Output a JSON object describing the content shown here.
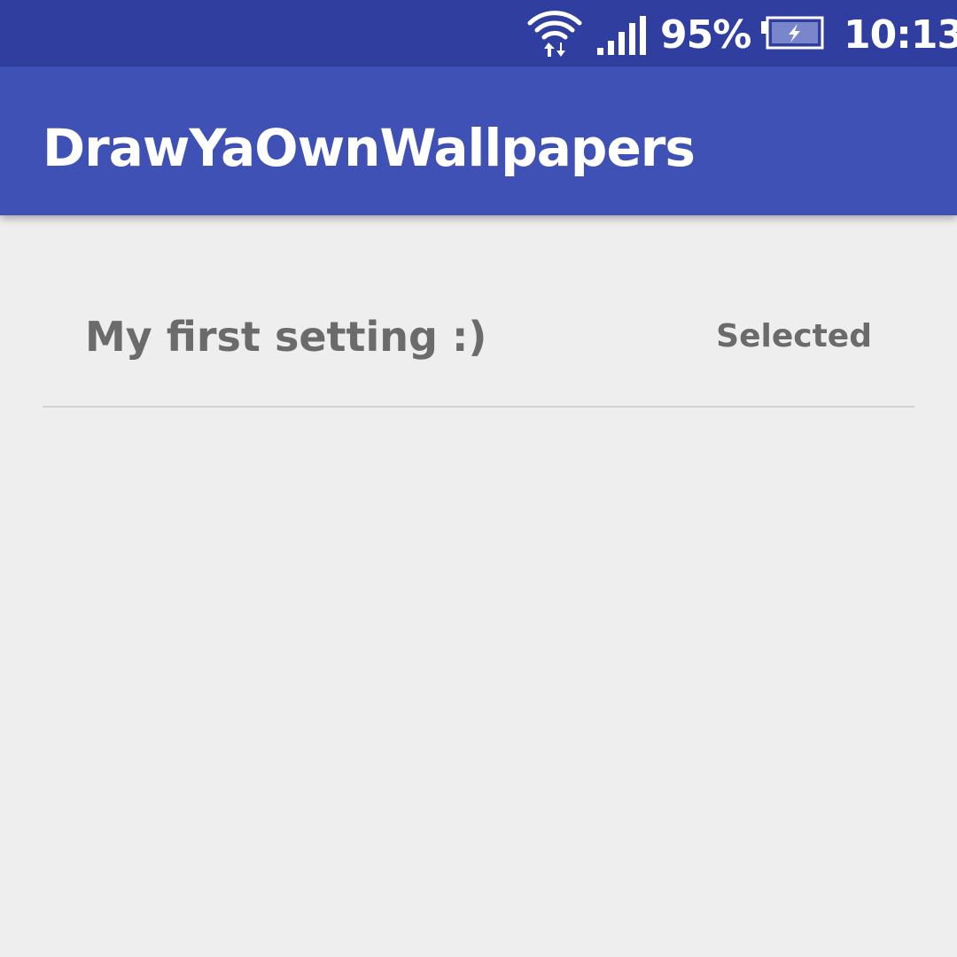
{
  "status_bar": {
    "wifi_icon": "wifi-data-icon",
    "signal_icon": "cell-signal-icon",
    "battery_percent": "95%",
    "battery_icon": "battery-charging-icon",
    "time": "10:13"
  },
  "app_bar": {
    "title": "DrawYaOwnWallpapers"
  },
  "preferences": [
    {
      "title": "My first setting :)",
      "summary": "Selected"
    }
  ],
  "colors": {
    "status_bar": "#303f9f",
    "app_bar": "#3f51b5",
    "background": "#eeeeee",
    "text_secondary": "#6b6b6b",
    "divider": "#d2d2d2"
  }
}
